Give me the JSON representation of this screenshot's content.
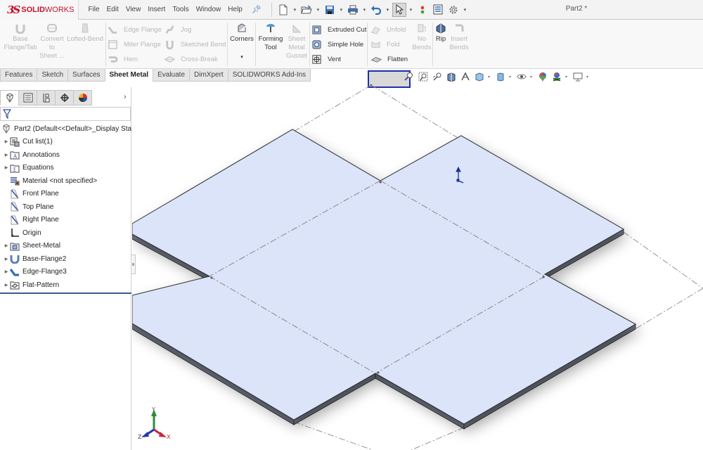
{
  "app": {
    "brand_prefix": "3S",
    "brand_bold": "SOLID",
    "brand_light": "WORKS",
    "document_title": "Part2 *"
  },
  "menu": [
    "File",
    "Edit",
    "View",
    "Insert",
    "Tools",
    "Window",
    "Help"
  ],
  "quick_access": [
    {
      "icon": "new-document-icon",
      "has_dropdown": true
    },
    {
      "icon": "open-folder-icon",
      "has_dropdown": true
    },
    {
      "icon": "save-icon",
      "has_dropdown": true
    },
    {
      "icon": "print-icon",
      "has_dropdown": true
    },
    {
      "icon": "undo-icon",
      "has_dropdown": true
    },
    {
      "icon": "select-cursor-icon",
      "has_dropdown": true,
      "active": true
    },
    {
      "icon": "rebuild-icon",
      "has_dropdown": false
    },
    {
      "icon": "file-properties-icon",
      "has_dropdown": false
    },
    {
      "icon": "options-gear-icon",
      "has_dropdown": true
    }
  ],
  "ribbon": {
    "base_flange": "Base\nFlange/Tab",
    "convert_to_sheet": "Convert\nto\nSheet ...",
    "lofted_bend": "Lofted-Bend",
    "edge_flange": "Edge Flange",
    "miter_flange": "Miter Flange",
    "hem": "Hem",
    "jog": "Jog",
    "sketched_bend": "Sketched Bend",
    "cross_break": "Cross-Break",
    "corners": "Corners",
    "forming_tool": "Forming\nTool",
    "sheet_metal_gusset": "Sheet\nMetal\nGusset",
    "extruded_cut": "Extruded Cut",
    "simple_hole": "Simple Hole",
    "vent": "Vent",
    "unfold": "Unfold",
    "fold": "Fold",
    "flatten": "Flatten",
    "no_bends": "No\nBends",
    "rip": "Rip",
    "insert_bends": "Insert\nBends"
  },
  "tabs": [
    {
      "label": "Features",
      "active": false
    },
    {
      "label": "Sketch",
      "active": false
    },
    {
      "label": "Surfaces",
      "active": false
    },
    {
      "label": "Sheet Metal",
      "active": true
    },
    {
      "label": "Evaluate",
      "active": false
    },
    {
      "label": "DimXpert",
      "active": false
    },
    {
      "label": "SOLIDWORKS Add-Ins",
      "active": false
    }
  ],
  "heads_up_toolbar": [
    "zoom-to-fit-icon",
    "zoom-to-area-icon",
    "previous-view-icon",
    "section-view-icon",
    "dynamic-annotation-icon",
    "view-orientation-icon",
    "display-style-icon",
    "hide-show-items-icon",
    "edit-appearance-icon",
    "apply-scene-icon",
    "view-settings-icon"
  ],
  "panel_tabs": [
    "feature-manager-icon",
    "property-manager-icon",
    "configuration-manager-icon",
    "dimxpert-manager-icon",
    "display-manager-icon"
  ],
  "tree": {
    "root": "Part2  (Default<<Default>_Display Sta",
    "items": [
      {
        "label": "Cut list(1)",
        "icon": "cut-list-icon",
        "expandable": true
      },
      {
        "label": "Annotations",
        "icon": "annotations-folder-icon",
        "expandable": true
      },
      {
        "label": "Equations",
        "icon": "equations-folder-icon",
        "expandable": true
      },
      {
        "label": "Material <not specified>",
        "icon": "material-icon",
        "expandable": false
      },
      {
        "label": "Front Plane",
        "icon": "plane-icon",
        "expandable": false
      },
      {
        "label": "Top Plane",
        "icon": "plane-icon",
        "expandable": false
      },
      {
        "label": "Right Plane",
        "icon": "plane-icon",
        "expandable": false
      },
      {
        "label": "Origin",
        "icon": "origin-icon",
        "expandable": false
      },
      {
        "label": "Sheet-Metal",
        "icon": "sheet-metal-icon",
        "expandable": true
      },
      {
        "label": "Base-Flange2",
        "icon": "base-flange-icon",
        "expandable": true
      },
      {
        "label": "Edge-Flange3",
        "icon": "edge-flange-icon",
        "expandable": true
      },
      {
        "label": "Flat-Pattern",
        "icon": "flat-pattern-icon",
        "expandable": true
      }
    ]
  },
  "triad": {
    "x": "X",
    "y": "Y",
    "z": "Z"
  },
  "colors": {
    "brand_red": "#c8102e",
    "face_fill": "#dce4fa",
    "selection_blue": "#1f2fa8",
    "axis_x": "#c8283c",
    "axis_y": "#2e8b3a",
    "axis_z": "#2436b8"
  }
}
